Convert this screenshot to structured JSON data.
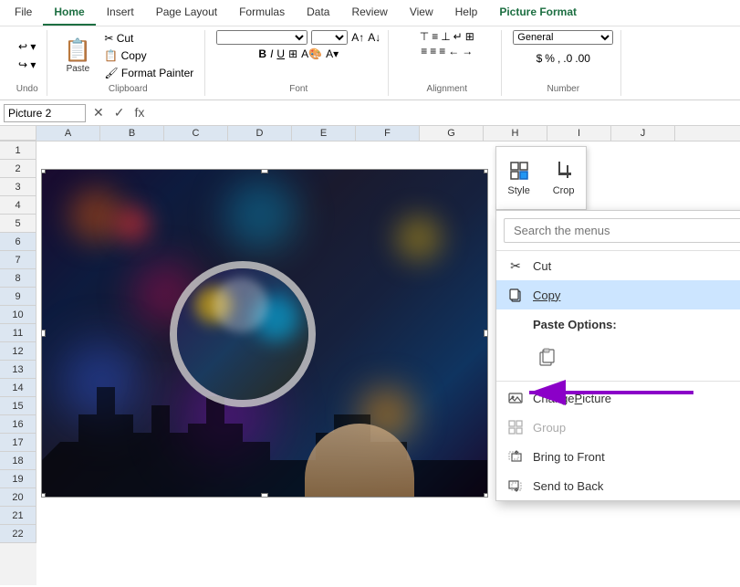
{
  "ribbon": {
    "tabs": [
      {
        "id": "file",
        "label": "File",
        "active": false
      },
      {
        "id": "home",
        "label": "Home",
        "active": true
      },
      {
        "id": "insert",
        "label": "Insert",
        "active": false
      },
      {
        "id": "page-layout",
        "label": "Page Layout",
        "active": false
      },
      {
        "id": "formulas",
        "label": "Formulas",
        "active": false
      },
      {
        "id": "data",
        "label": "Data",
        "active": false
      },
      {
        "id": "review",
        "label": "Review",
        "active": false
      },
      {
        "id": "view",
        "label": "View",
        "active": false
      },
      {
        "id": "help",
        "label": "Help",
        "active": false
      },
      {
        "id": "picture-format",
        "label": "Picture Format",
        "active": false,
        "special": true
      }
    ]
  },
  "formula_bar": {
    "name_box": "Picture 2",
    "fx_label": "fx"
  },
  "floating_toolbar": {
    "style_label": "Style",
    "crop_label": "Crop"
  },
  "context_menu": {
    "search_placeholder": "Search the menus",
    "items": [
      {
        "id": "cut",
        "label": "Cut",
        "icon": "✂",
        "has_arrow": false,
        "disabled": false,
        "bold": false
      },
      {
        "id": "copy",
        "label": "Copy",
        "icon": "📋",
        "has_arrow": false,
        "disabled": false,
        "bold": false
      },
      {
        "id": "paste-options",
        "label": "Paste Options:",
        "icon": null,
        "has_arrow": false,
        "disabled": false,
        "bold": true,
        "is_header": true
      },
      {
        "id": "paste-icon",
        "label": "",
        "icon": "📋",
        "is_paste_row": true
      },
      {
        "id": "change-picture",
        "label": "Change Picture",
        "icon": "🖼",
        "has_arrow": true,
        "disabled": false,
        "bold": false
      },
      {
        "id": "group",
        "label": "Group",
        "icon": "⊞",
        "has_arrow": true,
        "disabled": true,
        "bold": false
      },
      {
        "id": "bring-to-front",
        "label": "Bring to Front",
        "icon": "↑",
        "has_arrow": true,
        "disabled": false,
        "bold": false
      },
      {
        "id": "send-to-back",
        "label": "Send to Back",
        "icon": "↓",
        "has_arrow": true,
        "disabled": false,
        "bold": false
      }
    ]
  },
  "columns": [
    "A",
    "B",
    "C",
    "D",
    "E",
    "F",
    "G",
    "H",
    "I",
    "J"
  ],
  "rows": [
    1,
    2,
    3,
    4,
    5,
    6,
    7,
    8,
    9,
    10,
    11,
    12,
    13,
    14,
    15,
    16,
    17,
    18,
    19,
    20,
    21,
    22
  ],
  "colors": {
    "active_tab_green": "#1d6f42",
    "picture_format_green": "#1d6f42",
    "arrow_purple": "#8b00c8",
    "highlight_col": "#dce6f1"
  }
}
